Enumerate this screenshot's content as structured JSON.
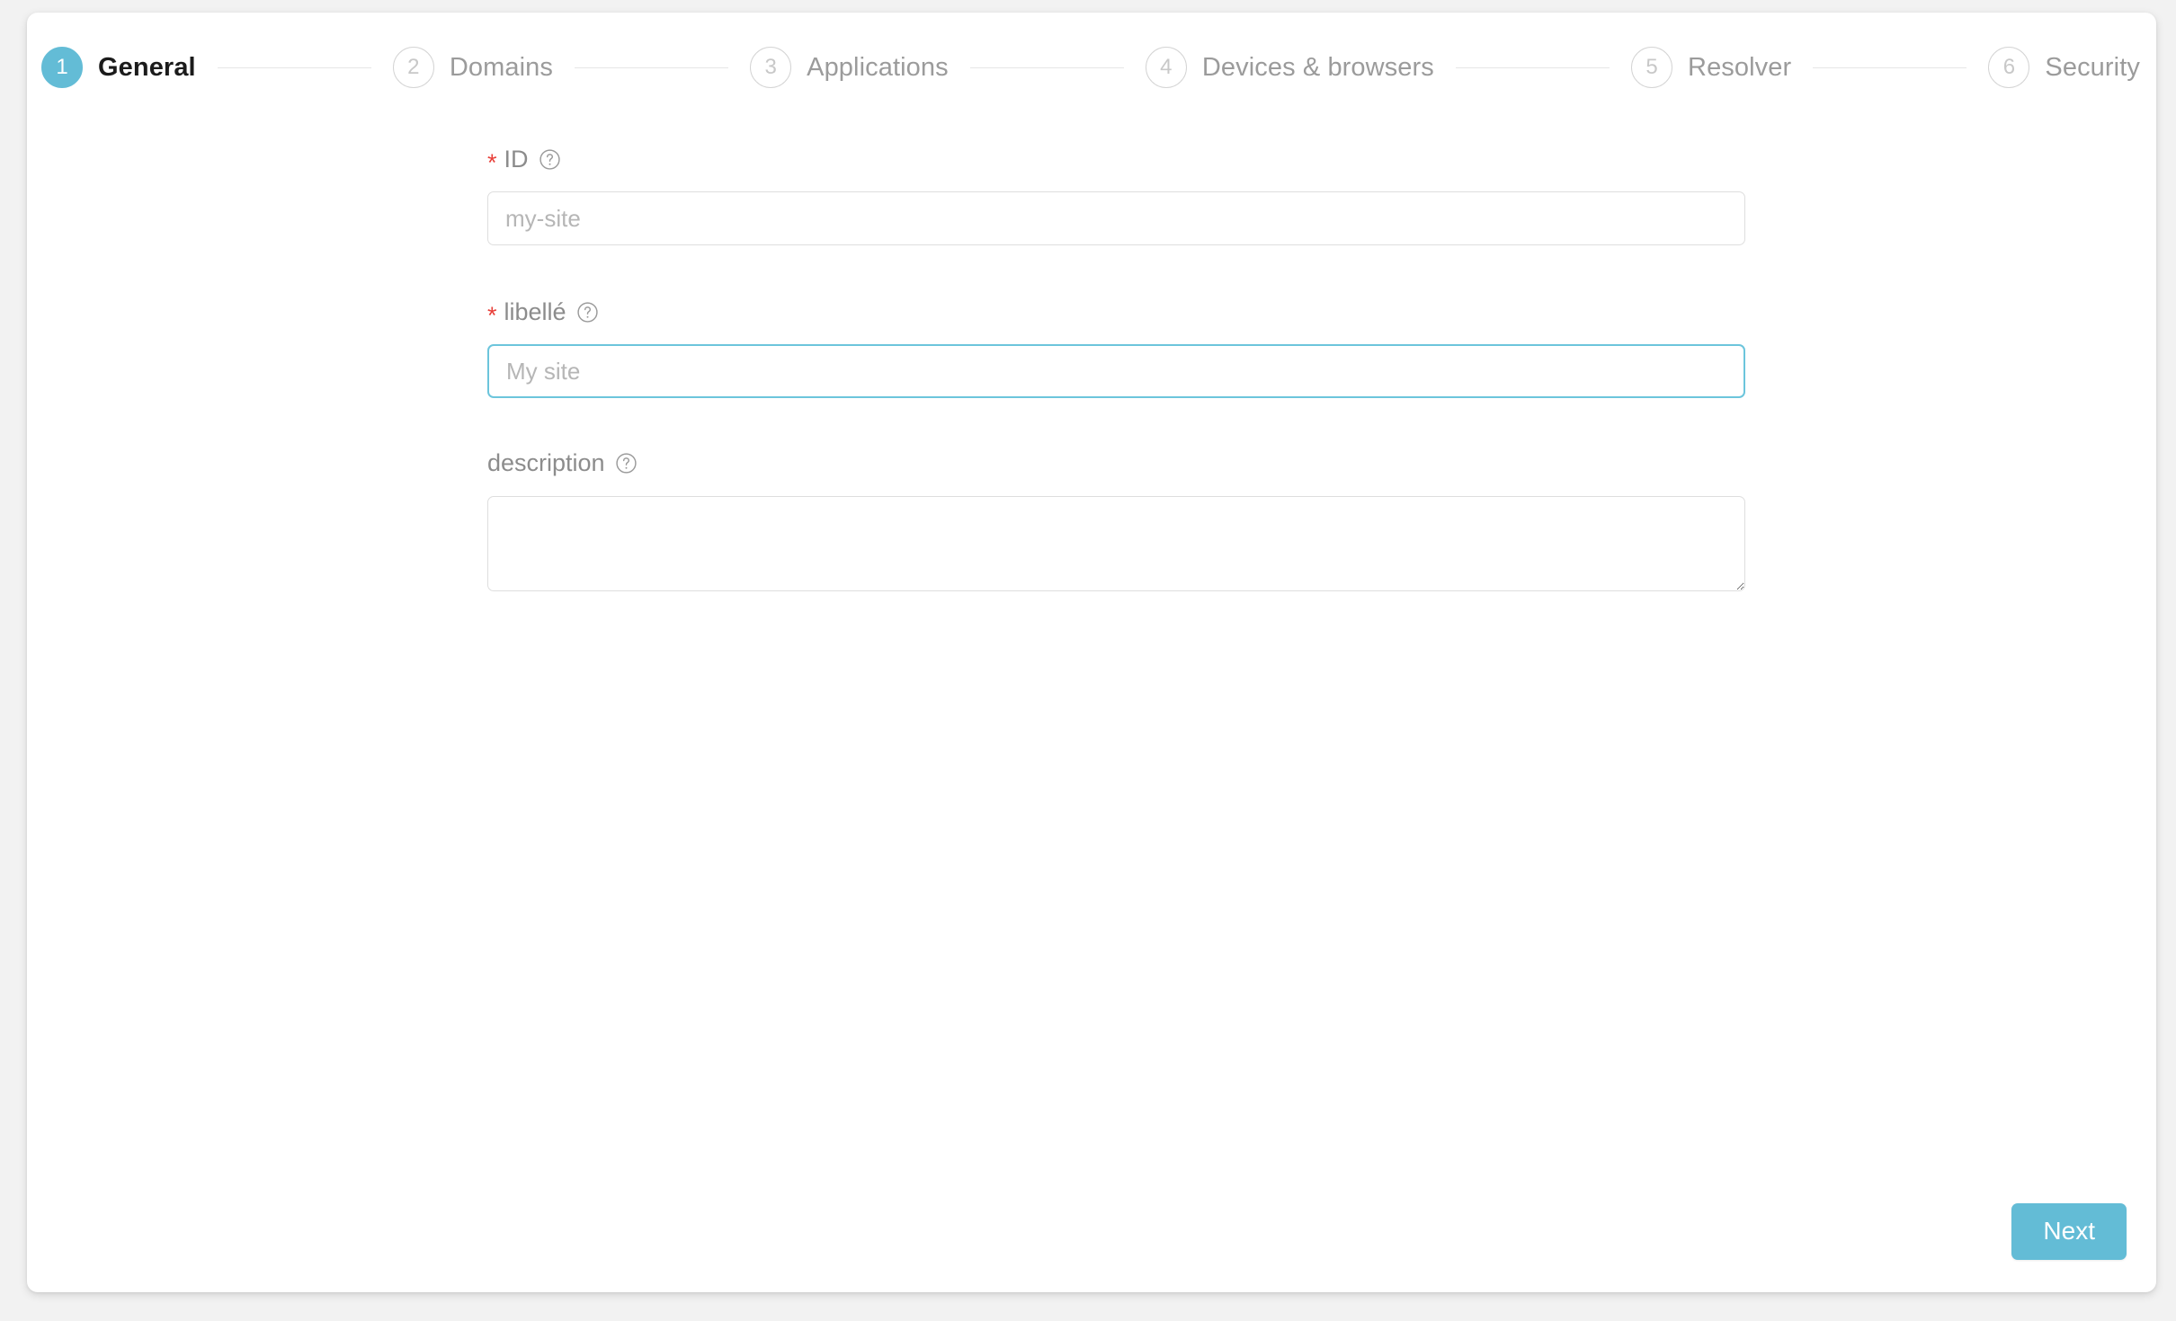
{
  "stepper": {
    "steps": [
      {
        "number": "1",
        "label": "General",
        "state": "active"
      },
      {
        "number": "2",
        "label": "Domains",
        "state": "inactive"
      },
      {
        "number": "3",
        "label": "Applications",
        "state": "inactive"
      },
      {
        "number": "4",
        "label": "Devices & browsers",
        "state": "inactive"
      },
      {
        "number": "5",
        "label": "Resolver",
        "state": "inactive"
      },
      {
        "number": "6",
        "label": "Security",
        "state": "inactive"
      }
    ],
    "active_color": "#63bcd6",
    "inactive_color": "#9b9b9b"
  },
  "form": {
    "id_field": {
      "label": "ID",
      "required_marker": "*",
      "help_icon": "help-circle-icon",
      "placeholder": "my-site",
      "value": ""
    },
    "label_field": {
      "label": "libellé",
      "required_marker": "*",
      "help_icon": "help-circle-icon",
      "placeholder": "My site",
      "value": "",
      "focused": true,
      "focus_color": "#6cc5dc"
    },
    "description_field": {
      "label": "description",
      "help_icon": "help-circle-icon",
      "placeholder": "",
      "value": ""
    }
  },
  "footer": {
    "next_label": "Next",
    "next_color": "#63bcd6"
  }
}
